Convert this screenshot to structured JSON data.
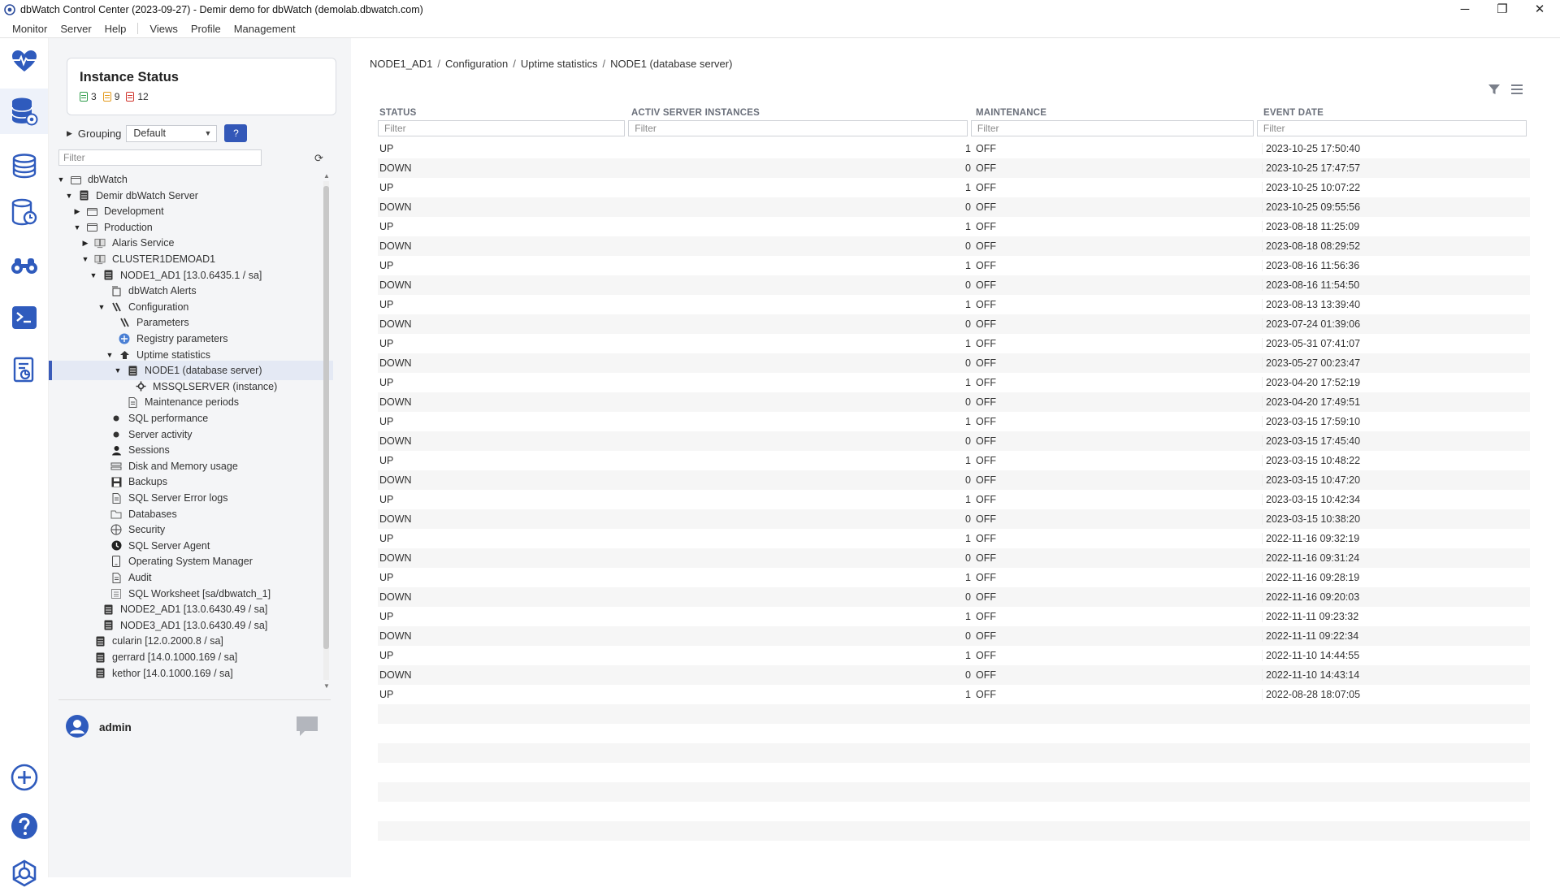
{
  "window": {
    "title": "dbWatch Control Center  (2023-09-27) - Demir demo for dbWatch (demolab.dbwatch.com)",
    "controls": [
      "─",
      "❐",
      "✕"
    ]
  },
  "menubar": {
    "items": [
      "Monitor",
      "Server",
      "Help"
    ],
    "items2": [
      "Views",
      "Profile",
      "Management"
    ]
  },
  "rail": {
    "icons": [
      "heart-monitor-icon",
      "database-settings-icon",
      "database-stack-icon",
      "database-clock-icon",
      "binoculars-icon",
      "terminal-icon",
      "report-icon",
      "add-icon",
      "help-icon",
      "settings-icon"
    ]
  },
  "instance_status": {
    "title": "Instance Status",
    "ok_count": "3",
    "warn_count": "9",
    "alarm_count": "12",
    "colors": {
      "ok": "#2e9c4a",
      "warn": "#e39a1c",
      "alarm": "#d0342c"
    }
  },
  "grouping": {
    "label": "Grouping",
    "value": "Default",
    "help": "?"
  },
  "sidebar_filter": {
    "placeholder": "Filter"
  },
  "tree": [
    {
      "label": "dbWatch",
      "indent": 0,
      "expander": "▼",
      "icon": "folder"
    },
    {
      "label": "Demir dbWatch Server",
      "indent": 1,
      "expander": "▼",
      "icon": "server"
    },
    {
      "label": "Development",
      "indent": 2,
      "expander": "▶",
      "icon": "folder"
    },
    {
      "label": "Production",
      "indent": 2,
      "expander": "▼",
      "icon": "folder"
    },
    {
      "label": "Alaris Service",
      "indent": 3,
      "expander": "▶",
      "icon": "cluster"
    },
    {
      "label": "CLUSTER1DEMOAD1",
      "indent": 3,
      "expander": "▼",
      "icon": "cluster"
    },
    {
      "label": "NODE1_AD1 [13.0.6435.1 / sa]",
      "indent": 4,
      "expander": "▼",
      "icon": "server"
    },
    {
      "label": "dbWatch Alerts",
      "indent": 5,
      "expander": "",
      "icon": "alerts"
    },
    {
      "label": "Configuration",
      "indent": 5,
      "expander": "▼",
      "icon": "config"
    },
    {
      "label": "Parameters",
      "indent": 6,
      "expander": "",
      "icon": "config"
    },
    {
      "label": "Registry parameters",
      "indent": 6,
      "expander": "",
      "icon": "registry"
    },
    {
      "label": "Uptime statistics",
      "indent": 6,
      "expander": "▼",
      "icon": "uptime"
    },
    {
      "label": "NODE1 (database server)",
      "indent": 7,
      "expander": "▼",
      "icon": "server",
      "selected": true
    },
    {
      "label": "MSSQLSERVER (instance)",
      "indent": 8,
      "expander": "",
      "icon": "instance"
    },
    {
      "label": "Maintenance periods",
      "indent": 7,
      "expander": "",
      "icon": "doc"
    },
    {
      "label": "SQL performance",
      "indent": 5,
      "expander": "",
      "icon": "dot"
    },
    {
      "label": "Server activity",
      "indent": 5,
      "expander": "",
      "icon": "dot"
    },
    {
      "label": "Sessions",
      "indent": 5,
      "expander": "",
      "icon": "person"
    },
    {
      "label": "Disk and Memory usage",
      "indent": 5,
      "expander": "",
      "icon": "disk"
    },
    {
      "label": "Backups",
      "indent": 5,
      "expander": "",
      "icon": "backup"
    },
    {
      "label": "SQL Server Error logs",
      "indent": 5,
      "expander": "",
      "icon": "doc"
    },
    {
      "label": "Databases",
      "indent": 5,
      "expander": "",
      "icon": "databases"
    },
    {
      "label": "Security",
      "indent": 5,
      "expander": "",
      "icon": "globe"
    },
    {
      "label": "SQL Server Agent",
      "indent": 5,
      "expander": "",
      "icon": "agent"
    },
    {
      "label": "Operating System Manager",
      "indent": 5,
      "expander": "",
      "icon": "phone"
    },
    {
      "label": "Audit",
      "indent": 5,
      "expander": "",
      "icon": "doc"
    },
    {
      "label": "SQL Worksheet [sa/dbwatch_1]",
      "indent": 5,
      "expander": "",
      "icon": "sheet"
    },
    {
      "label": "NODE2_AD1 [13.0.6430.49 / sa]",
      "indent": 4,
      "expander": "",
      "icon": "server"
    },
    {
      "label": "NODE3_AD1 [13.0.6430.49 / sa]",
      "indent": 4,
      "expander": "",
      "icon": "server"
    },
    {
      "label": "cularin [12.0.2000.8 / sa]",
      "indent": 3,
      "expander": "",
      "icon": "server"
    },
    {
      "label": "gerrard [14.0.1000.169 / sa]",
      "indent": 3,
      "expander": "",
      "icon": "server"
    },
    {
      "label": "kethor [14.0.1000.169 / sa]",
      "indent": 3,
      "expander": "",
      "icon": "server"
    }
  ],
  "user": {
    "name": "admin"
  },
  "breadcrumb": [
    "NODE1_AD1",
    "Configuration",
    "Uptime statistics",
    "NODE1 (database server)"
  ],
  "breadcrumb_sep": "/",
  "grid": {
    "columns": [
      "STATUS",
      "ACTIV SERVER INSTANCES",
      "MAINTENANCE",
      "EVENT DATE"
    ],
    "filter_placeholder": "Filter",
    "rows": [
      [
        "UP",
        "1",
        "OFF",
        "2023-10-25 17:50:40"
      ],
      [
        "DOWN",
        "0",
        "OFF",
        "2023-10-25 17:47:57"
      ],
      [
        "UP",
        "1",
        "OFF",
        "2023-10-25 10:07:22"
      ],
      [
        "DOWN",
        "0",
        "OFF",
        "2023-10-25 09:55:56"
      ],
      [
        "UP",
        "1",
        "OFF",
        "2023-08-18 11:25:09"
      ],
      [
        "DOWN",
        "0",
        "OFF",
        "2023-08-18 08:29:52"
      ],
      [
        "UP",
        "1",
        "OFF",
        "2023-08-16 11:56:36"
      ],
      [
        "DOWN",
        "0",
        "OFF",
        "2023-08-16 11:54:50"
      ],
      [
        "UP",
        "1",
        "OFF",
        "2023-08-13 13:39:40"
      ],
      [
        "DOWN",
        "0",
        "OFF",
        "2023-07-24 01:39:06"
      ],
      [
        "UP",
        "1",
        "OFF",
        "2023-05-31 07:41:07"
      ],
      [
        "DOWN",
        "0",
        "OFF",
        "2023-05-27 00:23:47"
      ],
      [
        "UP",
        "1",
        "OFF",
        "2023-04-20 17:52:19"
      ],
      [
        "DOWN",
        "0",
        "OFF",
        "2023-04-20 17:49:51"
      ],
      [
        "UP",
        "1",
        "OFF",
        "2023-03-15 17:59:10"
      ],
      [
        "DOWN",
        "0",
        "OFF",
        "2023-03-15 17:45:40"
      ],
      [
        "UP",
        "1",
        "OFF",
        "2023-03-15 10:48:22"
      ],
      [
        "DOWN",
        "0",
        "OFF",
        "2023-03-15 10:47:20"
      ],
      [
        "UP",
        "1",
        "OFF",
        "2023-03-15 10:42:34"
      ],
      [
        "DOWN",
        "0",
        "OFF",
        "2023-03-15 10:38:20"
      ],
      [
        "UP",
        "1",
        "OFF",
        "2022-11-16 09:32:19"
      ],
      [
        "DOWN",
        "0",
        "OFF",
        "2022-11-16 09:31:24"
      ],
      [
        "UP",
        "1",
        "OFF",
        "2022-11-16 09:28:19"
      ],
      [
        "DOWN",
        "0",
        "OFF",
        "2022-11-16 09:20:03"
      ],
      [
        "UP",
        "1",
        "OFF",
        "2022-11-11 09:23:32"
      ],
      [
        "DOWN",
        "0",
        "OFF",
        "2022-11-11 09:22:34"
      ],
      [
        "UP",
        "1",
        "OFF",
        "2022-11-10 14:44:55"
      ],
      [
        "DOWN",
        "0",
        "OFF",
        "2022-11-10 14:43:14"
      ],
      [
        "UP",
        "1",
        "OFF",
        "2022-08-28 18:07:05"
      ]
    ]
  },
  "accent_color": "#3358b8"
}
